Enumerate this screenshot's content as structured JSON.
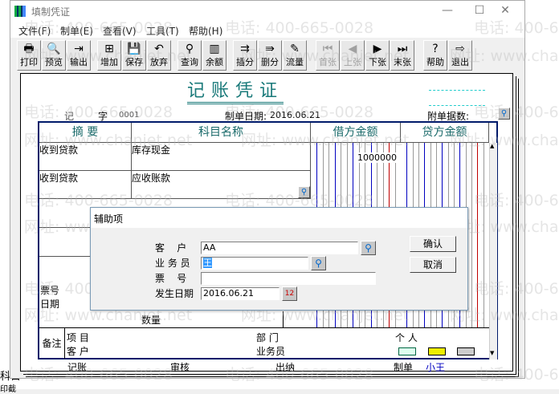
{
  "window": {
    "title": "填制凭证",
    "minimize": "—",
    "maximize": "☐",
    "close": "✕"
  },
  "menu": [
    "文件(F)",
    "制单(E)",
    "查看(V)",
    "工具(T)",
    "帮助(H)"
  ],
  "toolbar": [
    {
      "label": "打印",
      "icon": "🖶",
      "name": "print",
      "disabled": false
    },
    {
      "label": "预览",
      "icon": "🔍",
      "name": "preview",
      "disabled": false
    },
    {
      "label": "输出",
      "icon": "⇥",
      "name": "export",
      "disabled": false
    },
    {
      "label": "增加",
      "icon": "⊞",
      "name": "add",
      "disabled": false
    },
    {
      "label": "保存",
      "icon": "💾",
      "name": "save",
      "disabled": false
    },
    {
      "label": "放弃",
      "icon": "↶",
      "name": "discard",
      "disabled": false
    },
    {
      "label": "查询",
      "icon": "⚲",
      "name": "query",
      "disabled": false
    },
    {
      "label": "余额",
      "icon": "▥",
      "name": "balance",
      "disabled": false
    },
    {
      "label": "插分",
      "icon": "⇉",
      "name": "insert-line",
      "disabled": false
    },
    {
      "label": "删分",
      "icon": "⇛",
      "name": "delete-line",
      "disabled": false
    },
    {
      "label": "流量",
      "icon": "✎",
      "name": "cashflow",
      "disabled": false
    },
    {
      "label": "首张",
      "icon": "⏮",
      "name": "first",
      "disabled": true
    },
    {
      "label": "上张",
      "icon": "◀",
      "name": "previous",
      "disabled": true
    },
    {
      "label": "下张",
      "icon": "▶",
      "name": "next",
      "disabled": false
    },
    {
      "label": "末张",
      "icon": "⏭",
      "name": "last",
      "disabled": false
    },
    {
      "label": "帮助",
      "icon": "?",
      "name": "help",
      "disabled": false
    },
    {
      "label": "退出",
      "icon": "⇨",
      "name": "exit",
      "disabled": false
    }
  ],
  "voucher": {
    "title": "记账凭证",
    "type": "记",
    "type_suffix": "字",
    "number": "0001",
    "date_label": "制单日期:",
    "date": "2016.06.21",
    "attach_label": "附单据数:",
    "headers": {
      "summary": "摘 要",
      "account": "科目名称",
      "debit": "借方金额",
      "credit": "贷方金额"
    },
    "rows": [
      {
        "summary": "收到贷款",
        "account": "库存现金",
        "debit": "1000000",
        "credit": ""
      },
      {
        "summary": "收到贷款",
        "account": "应收账款",
        "debit": "",
        "credit": ""
      }
    ],
    "ticket_label": "票号",
    "date_row_label": "日期",
    "quantity_label": "数量",
    "notes": {
      "label": "备注",
      "project": "项  目",
      "dept": "部  门",
      "person": "个  人",
      "customer": "客  户",
      "salesman": "业务员"
    },
    "footer": {
      "bookkeep": "记账",
      "audit": "审核",
      "cashier": "出纳",
      "maker_label": "制单",
      "maker": "小王"
    }
  },
  "dialog": {
    "title": "辅助项",
    "customer_label": "客    户",
    "customer": "AA",
    "salesman_label": "业 务 员",
    "salesman": "王",
    "ticket_label": "票    号",
    "ticket": "",
    "date_label": "发生日期",
    "date": "2016.06.21",
    "ok": "确认",
    "cancel": "取消"
  },
  "watermark": {
    "phone": "电话: 400-665-0028",
    "site": "网址: www.chanjet.net"
  },
  "behind": {
    "text1": "科目",
    "text2": "印截"
  },
  "colors": {
    "accent": "#1a7a7a",
    "maker": "#0000c0",
    "grid_blue": "#0000c0",
    "grid_red": "#c00000"
  }
}
